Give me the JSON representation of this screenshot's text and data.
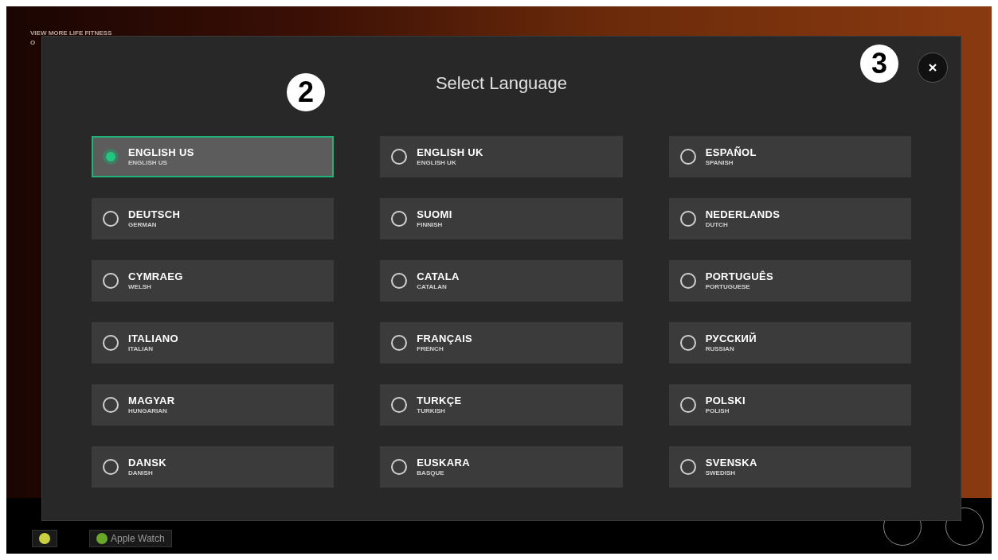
{
  "background": {
    "link_text": "VIEW MORE LIFE FITNESS",
    "link_text_2": "O",
    "device_buttons": [
      {
        "color": "#c8d040"
      },
      {
        "label": "Apple Watch",
        "color": "#6aa82a"
      }
    ]
  },
  "dialog": {
    "title": "Select Language",
    "languages": [
      {
        "name": "ENGLISH US",
        "sub": "ENGLISH US",
        "selected": true
      },
      {
        "name": "ENGLISH UK",
        "sub": "ENGLISH UK",
        "selected": false
      },
      {
        "name": "ESPAÑOL",
        "sub": "SPANISH",
        "selected": false
      },
      {
        "name": "DEUTSCH",
        "sub": "GERMAN",
        "selected": false
      },
      {
        "name": "SUOMI",
        "sub": "FINNISH",
        "selected": false
      },
      {
        "name": "NEDERLANDS",
        "sub": "DUTCH",
        "selected": false
      },
      {
        "name": "CYMRAEG",
        "sub": "WELSH",
        "selected": false
      },
      {
        "name": "CATALA",
        "sub": "CATALAN",
        "selected": false
      },
      {
        "name": "PORTUGUÊS",
        "sub": "PORTUGUESE",
        "selected": false
      },
      {
        "name": "ITALIANO",
        "sub": "ITALIAN",
        "selected": false
      },
      {
        "name": "FRANÇAIS",
        "sub": "FRENCH",
        "selected": false
      },
      {
        "name": "РУССКИЙ",
        "sub": "RUSSIAN",
        "selected": false
      },
      {
        "name": "MAGYAR",
        "sub": "HUNGARIAN",
        "selected": false
      },
      {
        "name": "TURKÇE",
        "sub": "TURKISH",
        "selected": false
      },
      {
        "name": "POLSKI",
        "sub": "POLISH",
        "selected": false
      },
      {
        "name": "DANSK",
        "sub": "DANISH",
        "selected": false
      },
      {
        "name": "EUSKARA",
        "sub": "BASQUE",
        "selected": false
      },
      {
        "name": "SVENSKA",
        "sub": "SWEDISH",
        "selected": false
      }
    ]
  },
  "annotations": [
    {
      "label": "2"
    },
    {
      "label": "3"
    }
  ]
}
